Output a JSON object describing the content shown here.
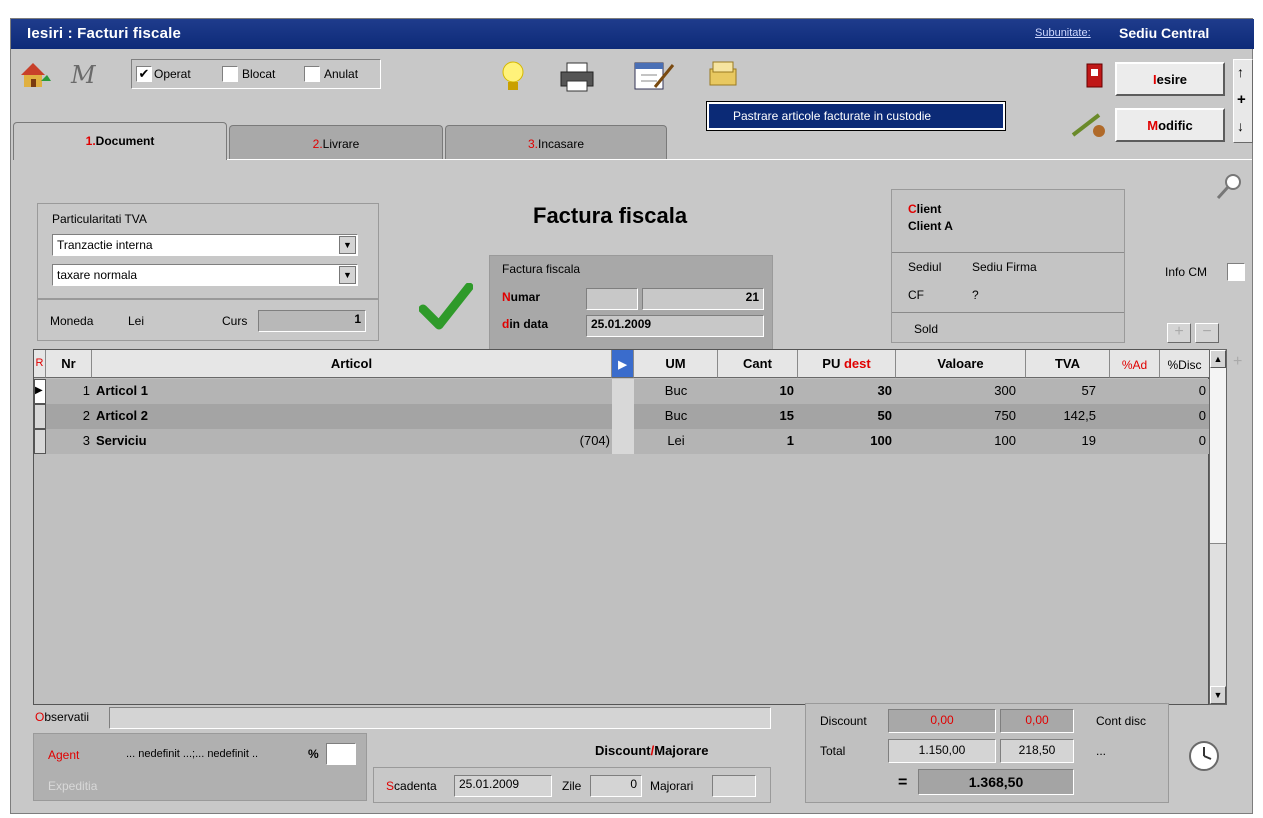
{
  "window": {
    "title": "Iesiri : Facturi fiscale",
    "subunit_label": "Subunitate:",
    "subunit_value": "Sediu Central"
  },
  "toolbar": {
    "checks": [
      {
        "label": "Operat",
        "checked": true
      },
      {
        "label": "Blocat",
        "checked": false
      },
      {
        "label": "Anulat",
        "checked": false
      }
    ],
    "custody_button": "Pastrare articole facturate in custodie",
    "exit_first": "I",
    "exit_rest": "esire",
    "modify_first": "M",
    "modify_rest": "odific"
  },
  "tabs": [
    {
      "num": "1.",
      "label": "Document"
    },
    {
      "num": "2.",
      "label": "Livrare"
    },
    {
      "num": "3.",
      "label": "Incasare"
    }
  ],
  "vat": {
    "title": "Particularitati TVA",
    "option1": "Tranzactie interna",
    "option2": "taxare normala"
  },
  "currency": {
    "label": "Moneda",
    "value": "Lei",
    "rate_label": "Curs",
    "rate": "1"
  },
  "document": {
    "heading": "Factura fiscala",
    "box_title": "Factura fiscala",
    "number_label_first": "N",
    "number_label_rest": "umar",
    "number": "21",
    "date_label_first": "d",
    "date_label_rest": "in data",
    "date": "25.01.2009"
  },
  "client": {
    "label_first": "C",
    "label_rest": "lient",
    "name": "Client A",
    "hq_label": "Sediul",
    "hq_value": "Sediu Firma",
    "cf_label": "CF",
    "cf_value": "?",
    "balance_label": "Sold"
  },
  "info_cm": "Info CM",
  "table": {
    "headers": {
      "r": "R",
      "nr": "Nr",
      "article": "Articol",
      "um": "UM",
      "qty": "Cant",
      "price_first": "PU ",
      "price_red": "dest",
      "value": "Valoare",
      "vat": "TVA",
      "ad": "%Ad",
      "disc": "%Disc"
    },
    "rows": [
      {
        "nr": "1",
        "article": "Articol 1",
        "code": "",
        "um": "Buc",
        "qty": "10",
        "price": "30",
        "value": "300",
        "vat": "57",
        "disc": "0"
      },
      {
        "nr": "2",
        "article": "Articol 2",
        "code": "",
        "um": "Buc",
        "qty": "15",
        "price": "50",
        "value": "750",
        "vat": "142,5",
        "disc": "0"
      },
      {
        "nr": "3",
        "article": "Serviciu",
        "code": "(704)",
        "um": "Lei",
        "qty": "1",
        "price": "100",
        "value": "100",
        "vat": "19",
        "disc": "0"
      }
    ]
  },
  "footer": {
    "obs_first": "O",
    "obs_rest": "bservatii",
    "agent_label": "Agent",
    "agent_value": "... nedefinit ...;... nedefinit ..",
    "agent_pct": "%",
    "expedition_label": "Expeditia",
    "discount_heading_a": "Discount",
    "discount_heading_sep": "/",
    "discount_heading_b": "Majorare",
    "due_first": "S",
    "due_rest": "cadenta",
    "due_date": "25.01.2009",
    "days_label": "Zile",
    "days": "0",
    "surcharge_label": "Majorari",
    "discount_label": "Discount",
    "discount_val": "0,00",
    "discount_vat": "0,00",
    "cont_disc_label": "Cont disc",
    "total_label": "Total",
    "total_val": "1.150,00",
    "total_vat": "218,50",
    "total_dots": "...",
    "eq": "=",
    "grand_total": "1.368,50"
  }
}
